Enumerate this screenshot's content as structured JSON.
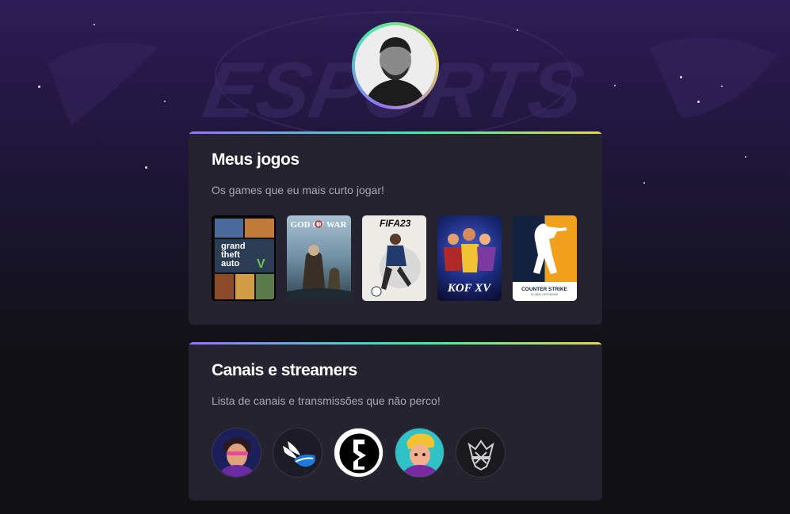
{
  "profile": {
    "avatar_alt": "profile-photo"
  },
  "games_card": {
    "title": "Meus jogos",
    "subtitle": "Os games que eu mais curto jogar!",
    "games": [
      {
        "name": "gta-v-cover",
        "label": "grand theft auto"
      },
      {
        "name": "god-of-war-cover",
        "label": "GOD OF WAR"
      },
      {
        "name": "fifa-23-cover",
        "label": "FIFA23"
      },
      {
        "name": "kof-xv-cover",
        "label": "KOF XV"
      },
      {
        "name": "counter-strike-cover",
        "label": "COUNTER STRIKE"
      }
    ]
  },
  "channels_card": {
    "title": "Canais e streamers",
    "subtitle": "Lista de canais e transmissões que não perco!",
    "channels": [
      {
        "name": "channel-avatar-1"
      },
      {
        "name": "channel-avatar-2"
      },
      {
        "name": "channel-avatar-3"
      },
      {
        "name": "channel-avatar-4"
      },
      {
        "name": "channel-avatar-5"
      }
    ]
  },
  "colors": {
    "accent_start": "#9572fc",
    "accent_mid": "#43e7ad",
    "accent_end": "#e2d45c",
    "card_bg": "#25232f"
  }
}
